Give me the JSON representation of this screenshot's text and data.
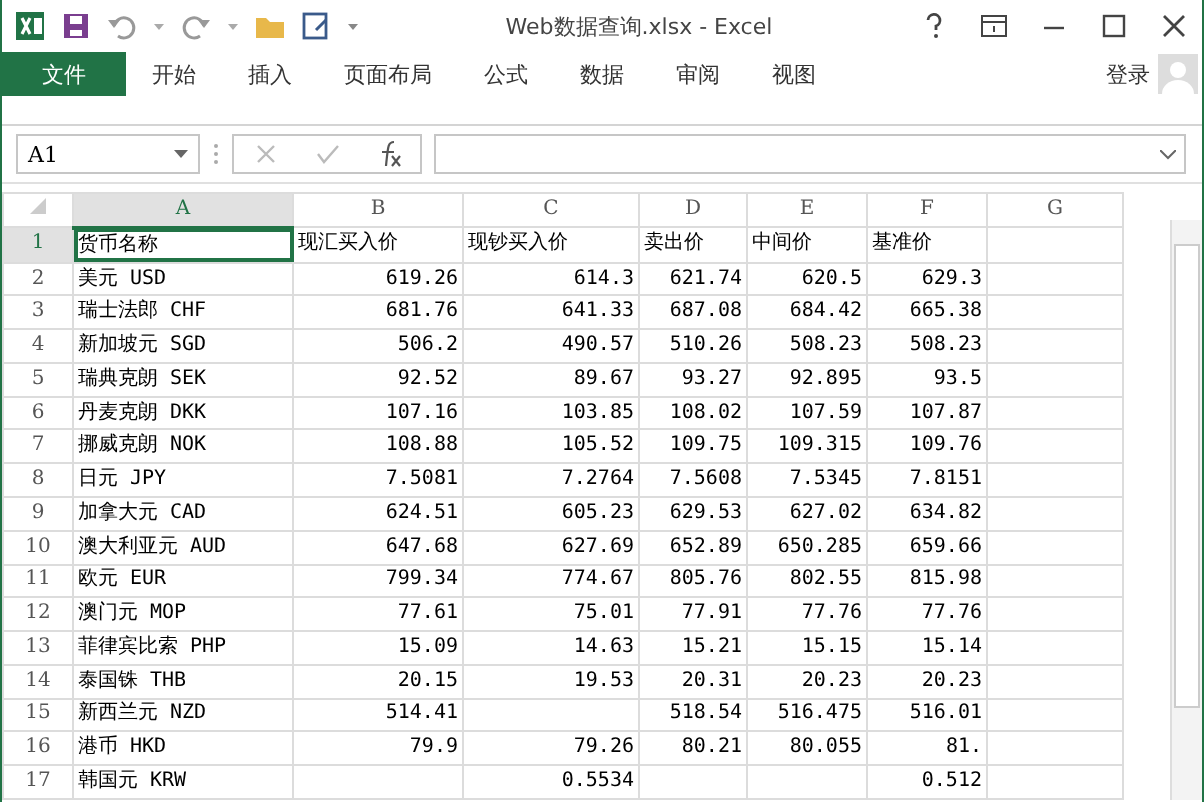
{
  "window": {
    "title": "Web数据查询.xlsx - Excel"
  },
  "ribbon_tabs": [
    {
      "label": "文件",
      "selected": true
    },
    {
      "label": "开始",
      "selected": false
    },
    {
      "label": "插入",
      "selected": false
    },
    {
      "label": "页面布局",
      "selected": false
    },
    {
      "label": "公式",
      "selected": false
    },
    {
      "label": "数据",
      "selected": false
    },
    {
      "label": "审阅",
      "selected": false
    },
    {
      "label": "视图",
      "selected": false
    }
  ],
  "sign_in": "登录",
  "name_box": "A1",
  "columns": [
    {
      "label": "A",
      "selected": true
    },
    {
      "label": "B",
      "selected": false
    },
    {
      "label": "C",
      "selected": false
    },
    {
      "label": "D",
      "selected": false
    },
    {
      "label": "E",
      "selected": false
    },
    {
      "label": "F",
      "selected": false
    },
    {
      "label": "G",
      "selected": false
    }
  ],
  "rows": [
    {
      "number": "1",
      "kind": "header",
      "selected": true,
      "cells": [
        "货币名称",
        "现汇买入价",
        "现钞买入价",
        "卖出价",
        "中间价",
        "基准价"
      ]
    },
    {
      "number": "2",
      "kind": "data",
      "selected": false,
      "cells": [
        "美元 USD",
        "619.26",
        "614.3",
        "621.74",
        "620.5",
        "629.3"
      ]
    },
    {
      "number": "3",
      "kind": "data",
      "selected": false,
      "cells": [
        "瑞士法郎 CHF",
        "681.76",
        "641.33",
        "687.08",
        "684.42",
        "665.38"
      ]
    },
    {
      "number": "4",
      "kind": "data",
      "selected": false,
      "cells": [
        "新加坡元 SGD",
        "506.2",
        "490.57",
        "510.26",
        "508.23",
        "508.23"
      ]
    },
    {
      "number": "5",
      "kind": "data",
      "selected": false,
      "cells": [
        "瑞典克朗 SEK",
        "92.52",
        "89.67",
        "93.27",
        "92.895",
        "93.5"
      ]
    },
    {
      "number": "6",
      "kind": "data",
      "selected": false,
      "cells": [
        "丹麦克朗 DKK",
        "107.16",
        "103.85",
        "108.02",
        "107.59",
        "107.87"
      ]
    },
    {
      "number": "7",
      "kind": "data",
      "selected": false,
      "cells": [
        "挪威克朗 NOK",
        "108.88",
        "105.52",
        "109.75",
        "109.315",
        "109.76"
      ]
    },
    {
      "number": "8",
      "kind": "data",
      "selected": false,
      "cells": [
        "日元 JPY",
        "7.5081",
        "7.2764",
        "7.5608",
        "7.5345",
        "7.8151"
      ]
    },
    {
      "number": "9",
      "kind": "data",
      "selected": false,
      "cells": [
        "加拿大元 CAD",
        "624.51",
        "605.23",
        "629.53",
        "627.02",
        "634.82"
      ]
    },
    {
      "number": "10",
      "kind": "data",
      "selected": false,
      "cells": [
        "澳大利亚元 AUD",
        "647.68",
        "627.69",
        "652.89",
        "650.285",
        "659.66"
      ]
    },
    {
      "number": "11",
      "kind": "data",
      "selected": false,
      "cells": [
        "欧元 EUR",
        "799.34",
        "774.67",
        "805.76",
        "802.55",
        "815.98"
      ]
    },
    {
      "number": "12",
      "kind": "data",
      "selected": false,
      "cells": [
        "澳门元 MOP",
        "77.61",
        "75.01",
        "77.91",
        "77.76",
        "77.76"
      ]
    },
    {
      "number": "13",
      "kind": "data",
      "selected": false,
      "cells": [
        "菲律宾比索 PHP",
        "15.09",
        "14.63",
        "15.21",
        "15.15",
        "15.14"
      ]
    },
    {
      "number": "14",
      "kind": "data",
      "selected": false,
      "cells": [
        "泰国铢 THB",
        "20.15",
        "19.53",
        "20.31",
        "20.23",
        "20.23"
      ]
    },
    {
      "number": "15",
      "kind": "data",
      "selected": false,
      "cells": [
        "新西兰元 NZD",
        "514.41",
        null,
        "518.54",
        "516.475",
        "516.01"
      ]
    },
    {
      "number": "16",
      "kind": "data",
      "selected": false,
      "cells": [
        "港币 HKD",
        "79.9",
        "79.26",
        "80.21",
        "80.055",
        "81."
      ]
    },
    {
      "number": "17",
      "kind": "data",
      "selected": false,
      "cells": [
        "韩国元 KRW",
        null,
        "0.5534",
        null,
        null,
        "0.512"
      ]
    }
  ]
}
